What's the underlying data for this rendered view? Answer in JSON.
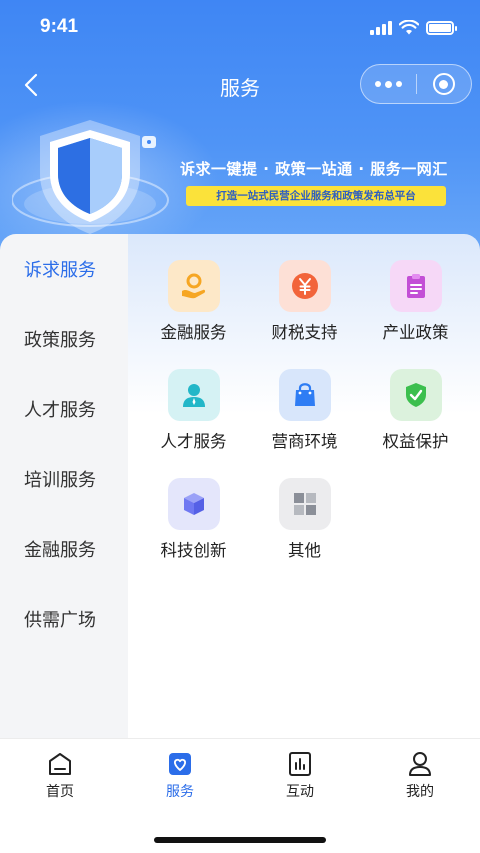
{
  "status_bar": {
    "time": "9:41"
  },
  "nav": {
    "title": "服务"
  },
  "banner": {
    "slogan": "诉求一键提 · 政策一站通 · 服务一网汇",
    "sub_slogan": "打造一站式民营企业服务和政策发布总平台"
  },
  "sidebar": {
    "items": [
      {
        "label": "诉求服务",
        "active": true
      },
      {
        "label": "政策服务",
        "active": false
      },
      {
        "label": "人才服务",
        "active": false
      },
      {
        "label": "培训服务",
        "active": false
      },
      {
        "label": "金融服务",
        "active": false
      },
      {
        "label": "供需广场",
        "active": false
      }
    ]
  },
  "services": [
    {
      "label": "金融服务",
      "icon": "finance-icon",
      "color": "#f6a623",
      "bg": "#fde8c8"
    },
    {
      "label": "财税支持",
      "icon": "yuan-icon",
      "color": "#f2643a",
      "bg": "#fde0d6"
    },
    {
      "label": "产业政策",
      "icon": "clipboard-icon",
      "color": "#c34fd6",
      "bg": "#f6d8f7"
    },
    {
      "label": "人才服务",
      "icon": "person-icon",
      "color": "#22b7c8",
      "bg": "#d5f2f4"
    },
    {
      "label": "营商环境",
      "icon": "shopping-bag-icon",
      "color": "#2f7df4",
      "bg": "#d8e6fb"
    },
    {
      "label": "权益保护",
      "icon": "shield-check-icon",
      "color": "#3cbf4e",
      "bg": "#dcf2dd"
    },
    {
      "label": "科技创新",
      "icon": "cube-icon",
      "color": "#6f78f2",
      "bg": "#e4e6fb"
    },
    {
      "label": "其他",
      "icon": "grid-icon",
      "color": "#8b8f98",
      "bg": "#ececee"
    }
  ],
  "tab_bar": {
    "tabs": [
      {
        "label": "首页",
        "icon": "home-icon",
        "active": false
      },
      {
        "label": "服务",
        "icon": "heart-icon",
        "active": true
      },
      {
        "label": "互动",
        "icon": "chart-icon",
        "active": false
      },
      {
        "label": "我的",
        "icon": "user-icon",
        "active": false
      }
    ]
  },
  "colors": {
    "accent": "#2b6de9",
    "header": "#3f86f4",
    "highlight": "#fbe23a"
  }
}
